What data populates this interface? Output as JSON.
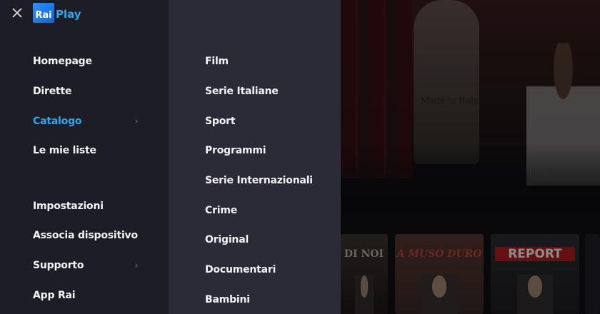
{
  "logo": {
    "rai": "Rai",
    "play": "Play"
  },
  "nav": {
    "items": [
      {
        "label": "Homepage"
      },
      {
        "label": "Dirette"
      },
      {
        "label": "Catalogo",
        "chevron": "›"
      },
      {
        "label": "Le mie liste"
      },
      {
        "label": "Impostazioni"
      },
      {
        "label": "Associa dispositivo"
      },
      {
        "label": "Supporto",
        "chevron": "›"
      },
      {
        "label": "App Rai"
      }
    ],
    "active": "Catalogo"
  },
  "submenu": {
    "items": [
      {
        "label": "Film"
      },
      {
        "label": "Serie Italiane"
      },
      {
        "label": "Sport"
      },
      {
        "label": "Programmi"
      },
      {
        "label": "Serie Internazionali"
      },
      {
        "label": "Crime"
      },
      {
        "label": "Original"
      },
      {
        "label": "Documentari"
      },
      {
        "label": "Bambini"
      }
    ]
  },
  "background": {
    "hero_text": "Made in Italy",
    "cards": [
      {
        "title": "DI NOI"
      },
      {
        "title": "A MUSO DURO"
      },
      {
        "title": "REPORT"
      }
    ]
  },
  "colors": {
    "accent": "#2ea7f4",
    "menu_bg": "#1d1d26",
    "submenu_bg": "#2b2b38"
  },
  "icons": {
    "close": "close-icon",
    "chevron": "chevron-right-icon"
  }
}
